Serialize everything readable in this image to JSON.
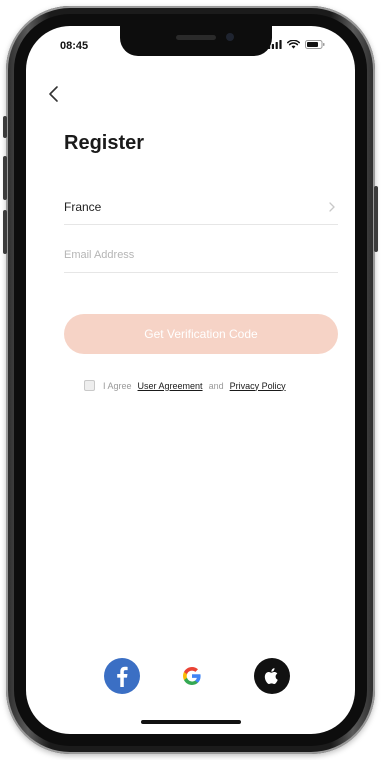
{
  "status_bar": {
    "time": "08:45",
    "icons": [
      "signal-icon",
      "wifi-icon",
      "battery-icon"
    ]
  },
  "header": {
    "back_icon": "chevron-left-icon",
    "title": "Register"
  },
  "form": {
    "country": {
      "value": "France",
      "icon": "chevron-right-icon"
    },
    "email": {
      "placeholder": "Email Address",
      "value": ""
    },
    "submit_label": "Get Verification Code"
  },
  "agreement": {
    "checked": false,
    "prefix": "I Agree",
    "user_agreement": "User Agreement",
    "conjunction": "and",
    "privacy_policy": "Privacy Policy"
  },
  "social_login": [
    {
      "name": "facebook-icon",
      "color": "#3b6fc4"
    },
    {
      "name": "google-icon",
      "color": "#ea4335"
    },
    {
      "name": "apple-icon",
      "color": "#111111"
    }
  ],
  "colors": {
    "accent_disabled": "#f6d3c6",
    "text_primary": "#1a1a1a",
    "placeholder": "#b5b5b5"
  }
}
